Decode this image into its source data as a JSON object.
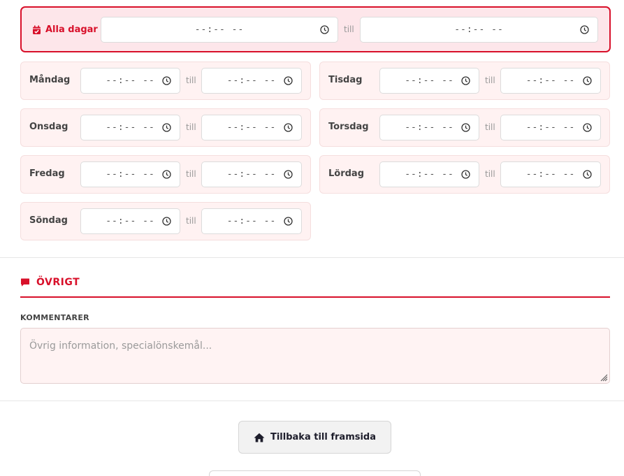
{
  "all_days": {
    "label": "Alla dagar",
    "from_value": "--:-- --",
    "till": "till",
    "to_value": "--:-- --"
  },
  "days": [
    {
      "label": "Måndag",
      "from_value": "--:-- --",
      "till": "till",
      "to_value": "--:-- --"
    },
    {
      "label": "Tisdag",
      "from_value": "--:-- --",
      "till": "till",
      "to_value": "--:-- --"
    },
    {
      "label": "Onsdag",
      "from_value": "--:-- --",
      "till": "till",
      "to_value": "--:-- --"
    },
    {
      "label": "Torsdag",
      "from_value": "--:-- --",
      "till": "till",
      "to_value": "--:-- --"
    },
    {
      "label": "Fredag",
      "from_value": "--:-- --",
      "till": "till",
      "to_value": "--:-- --"
    },
    {
      "label": "Lördag",
      "from_value": "--:-- --",
      "till": "till",
      "to_value": "--:-- --"
    },
    {
      "label": "Söndag",
      "from_value": "--:-- --",
      "till": "till",
      "to_value": "--:-- --"
    }
  ],
  "other": {
    "heading": "ÖVRIGT",
    "comments_label": "KOMMENTARER",
    "comments_placeholder": "Övrig information, specialönskemål..."
  },
  "actions": {
    "home_label": "Tillbaka till framsida"
  },
  "colors": {
    "accent": "#d8102a",
    "card_bg": "#fff2f2",
    "all_days_bg": "#fde6ea"
  },
  "icons": [
    "calendar-check-icon",
    "clock-icon",
    "comment-icon",
    "home-icon",
    "resize-grip-icon"
  ]
}
